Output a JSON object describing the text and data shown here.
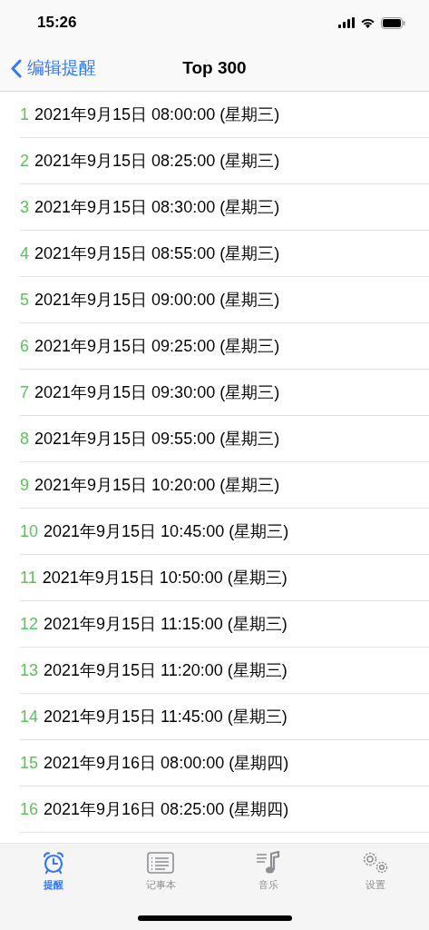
{
  "status_bar": {
    "time": "15:26"
  },
  "nav_bar": {
    "back": "编辑提醒",
    "title": "Top 300"
  },
  "reminders": [
    {
      "index": "1",
      "text": "2021年9月15日 08:00:00 (星期三)"
    },
    {
      "index": "2",
      "text": "2021年9月15日 08:25:00 (星期三)"
    },
    {
      "index": "3",
      "text": "2021年9月15日 08:30:00 (星期三)"
    },
    {
      "index": "4",
      "text": "2021年9月15日 08:55:00 (星期三)"
    },
    {
      "index": "5",
      "text": "2021年9月15日 09:00:00 (星期三)"
    },
    {
      "index": "6",
      "text": "2021年9月15日 09:25:00 (星期三)"
    },
    {
      "index": "7",
      "text": "2021年9月15日 09:30:00 (星期三)"
    },
    {
      "index": "8",
      "text": "2021年9月15日 09:55:00 (星期三)"
    },
    {
      "index": "9",
      "text": "2021年9月15日 10:20:00 (星期三)"
    },
    {
      "index": "10",
      "text": "2021年9月15日 10:45:00 (星期三)"
    },
    {
      "index": "11",
      "text": "2021年9月15日 10:50:00 (星期三)"
    },
    {
      "index": "12",
      "text": "2021年9月15日 11:15:00 (星期三)"
    },
    {
      "index": "13",
      "text": "2021年9月15日 11:20:00 (星期三)"
    },
    {
      "index": "14",
      "text": "2021年9月15日 11:45:00 (星期三)"
    },
    {
      "index": "15",
      "text": "2021年9月16日 08:00:00 (星期四)"
    },
    {
      "index": "16",
      "text": "2021年9月16日 08:25:00 (星期四)"
    }
  ],
  "tab_bar": [
    {
      "kind": "alarm",
      "label": "提醒",
      "selected": true
    },
    {
      "kind": "notes",
      "label": "记事本",
      "selected": false
    },
    {
      "kind": "music",
      "label": "音乐",
      "selected": false
    },
    {
      "kind": "settings",
      "label": "设置",
      "selected": false
    }
  ]
}
